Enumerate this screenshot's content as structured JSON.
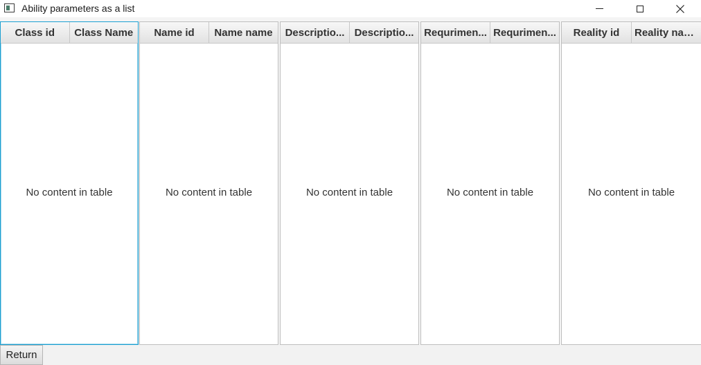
{
  "window": {
    "title": "Ability parameters as a list",
    "controls": {
      "minimize": "minimize-icon",
      "maximize": "maximize-icon",
      "close": "close-icon"
    }
  },
  "tables": [
    {
      "columns": [
        "Class id",
        "Class Name"
      ],
      "placeholder": "No content in table"
    },
    {
      "columns": [
        "Name id",
        "Name name"
      ],
      "placeholder": "No content in table"
    },
    {
      "columns": [
        "Descriptio...",
        "Descriptio..."
      ],
      "placeholder": "No content in table"
    },
    {
      "columns": [
        "Requrimen...",
        "Requrimen..."
      ],
      "placeholder": "No content in table"
    },
    {
      "columns": [
        "Reality id",
        "Reality name"
      ],
      "placeholder": "No content in table"
    }
  ],
  "footer": {
    "return_label": "Return"
  },
  "colors": {
    "focus_border": "#1a9fd1",
    "header_bg": "#e8e8e8",
    "table_bg": "#ffffff"
  }
}
